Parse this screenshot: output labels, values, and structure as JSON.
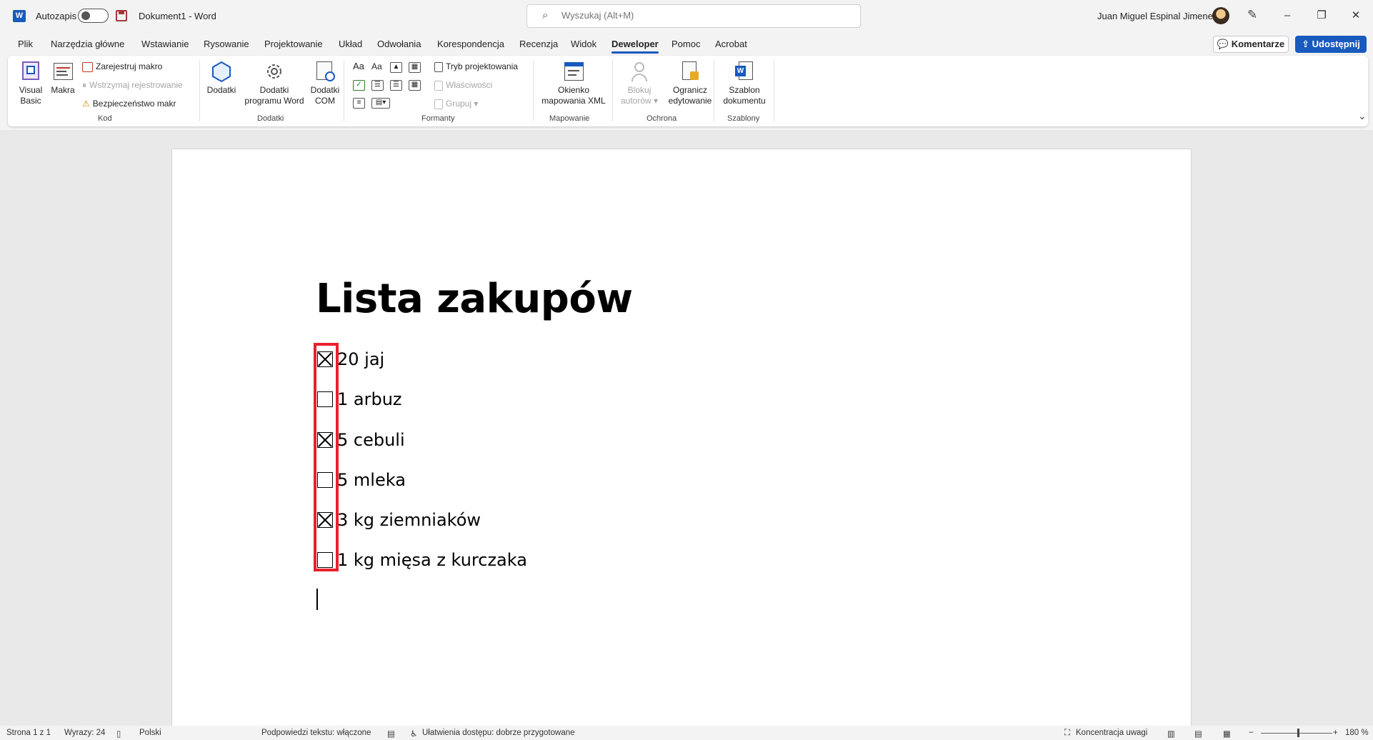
{
  "app": {
    "autosave_label": "Autozapis",
    "doc_title": "Dokument1  -  Word",
    "user_name": "Juan Miguel Espinal Jimenez",
    "search": {
      "placeholder": "Wyszukaj (Alt+M)"
    },
    "window_controls": {
      "minimize": "–",
      "restore": "❐",
      "close": "✕"
    }
  },
  "menu": {
    "tabs": [
      "Plik",
      "Narzędzia główne",
      "Wstawianie",
      "Rysowanie",
      "Projektowanie",
      "Układ",
      "Odwołania",
      "Korespondencja",
      "Recenzja",
      "Widok",
      "Deweloper",
      "Pomoc",
      "Acrobat"
    ],
    "active_tab": "Deweloper",
    "comments": "Komentarze",
    "share": "Udostępnij"
  },
  "ribbon": {
    "kod": {
      "label": "Kod",
      "visual_basic": "Visual Basic",
      "visual_basic_l1": "Visual",
      "visual_basic_l2": "Basic",
      "macros": "Makra",
      "record_macro": "Zarejestruj makro",
      "pause_recording": "Wstrzymaj rejestrowanie",
      "macro_security": "Bezpieczeństwo makr"
    },
    "dodatki": {
      "label": "Dodatki",
      "addins": "Dodatki",
      "word_addins_l1": "Dodatki",
      "word_addins_l2": "programu Word",
      "com_addins_l1": "Dodatki",
      "com_addins_l2": "COM"
    },
    "formanty": {
      "label": "Formanty",
      "design_mode": "Tryb projektowania",
      "properties": "Właściwości",
      "group": "Grupuj"
    },
    "mapowanie": {
      "label": "Mapowanie",
      "xml_pane_l1": "Okienko",
      "xml_pane_l2": "mapowania XML"
    },
    "ochrona": {
      "label": "Ochrona",
      "block_authors_l1": "Blokuj",
      "block_authors_l2": "autorów",
      "restrict_l1": "Ogranicz",
      "restrict_l2": "edytowanie"
    },
    "szablony": {
      "label": "Szablony",
      "template_l1": "Szablon",
      "template_l2": "dokumentu"
    }
  },
  "document": {
    "heading": "Lista zakupów",
    "items": [
      {
        "text": "20 jaj",
        "checked": true
      },
      {
        "text": "1 arbuz",
        "checked": false
      },
      {
        "text": "5 cebuli",
        "checked": true
      },
      {
        "text": "5 mleka",
        "checked": false
      },
      {
        "text": "3 kg ziemniaków",
        "checked": true
      },
      {
        "text": "1 kg mięsa z kurczaka",
        "checked": false
      }
    ]
  },
  "status": {
    "page": "Strona 1 z 1",
    "words": "Wyrazy: 24",
    "language": "Polski",
    "text_predictions": "Podpowiedzi tekstu: włączone",
    "accessibility": "Ułatwienia dostępu: dobrze przygotowane",
    "focus": "Koncentracja uwagi",
    "zoom": "180 %"
  },
  "colors": {
    "accent": "#185abd",
    "highlight": "#e8212d"
  }
}
